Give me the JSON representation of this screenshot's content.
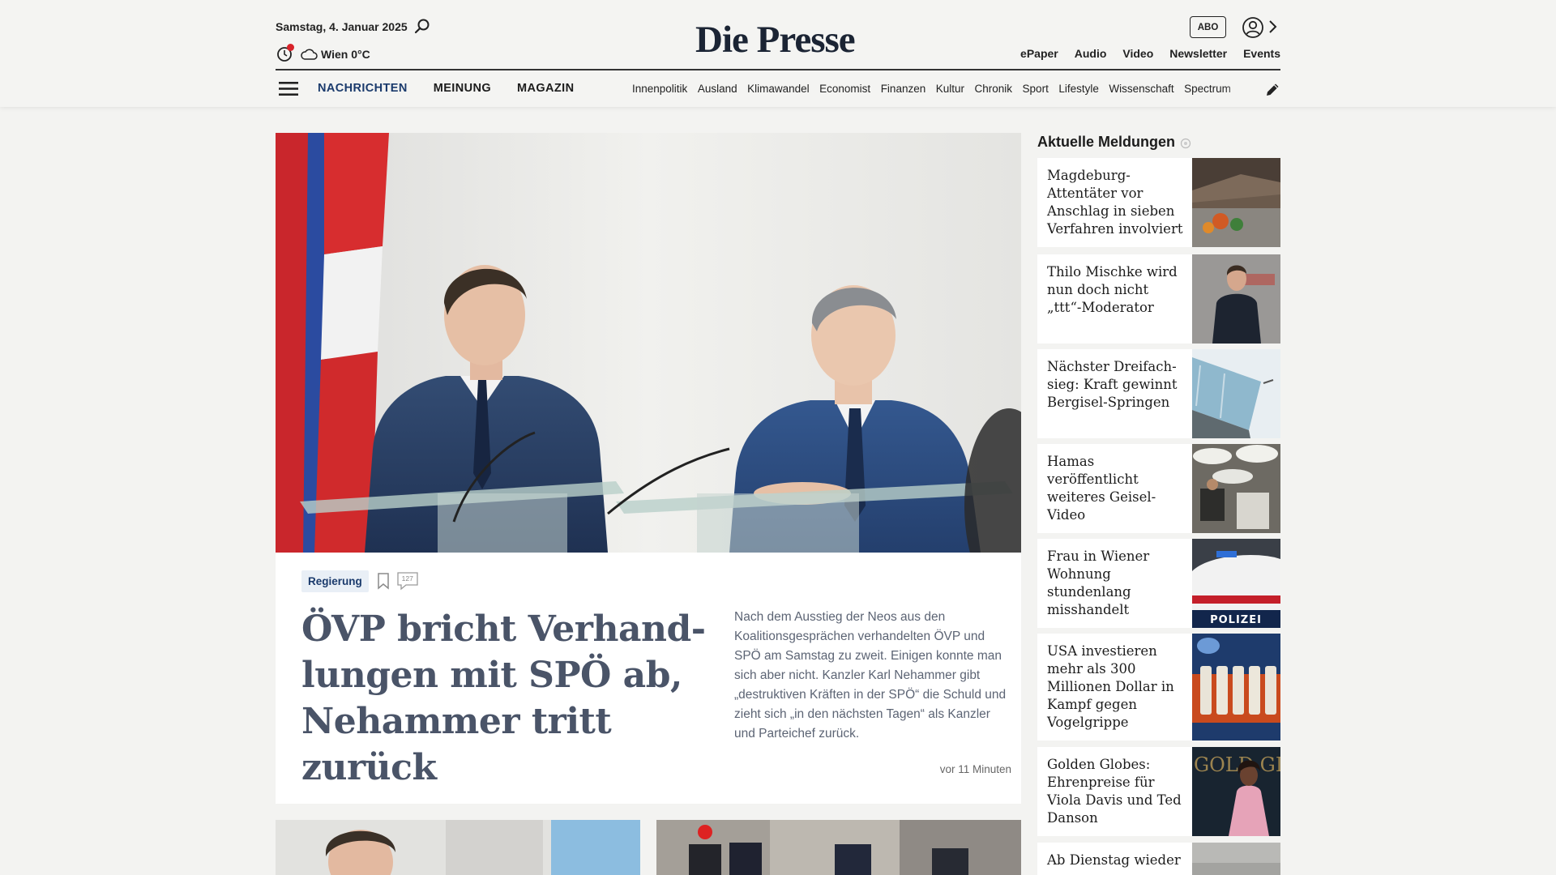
{
  "header": {
    "date": "Samstag, 4. Januar 2025",
    "weather": "Wien 0°C",
    "logo": "Die Presse",
    "abo_label": "ABO",
    "top_links": [
      "ePaper",
      "Audio",
      "Video",
      "Newsletter",
      "Events"
    ],
    "main_nav": [
      "NACHRICHTEN",
      "MEINUNG",
      "MAGAZIN"
    ],
    "sub_nav": [
      "Innenpolitik",
      "Ausland",
      "Klimawandel",
      "Economist",
      "Finanzen",
      "Kultur",
      "Chronik",
      "Sport",
      "Lifestyle",
      "Wissenschaft",
      "Spectrum"
    ]
  },
  "lead": {
    "category": "Regierung",
    "comment_count": "127",
    "headline": "ÖVP bricht Verhand­lungen mit SPÖ ab, Nehammer tritt zurück",
    "teaser": "Nach dem Ausstieg der Neos aus den Koalitionsgesprächen verhandelten ÖVP und SPÖ am Samstag zu zweit. Einigen konnte man sich aber nicht. Kanzler Karl Nehammer gibt „destruktiven Kräften in der SPÖ“ die Schuld und zieht sich „in den nächsten Tagen“ als Kanzler und Parteichef zurück.",
    "time": "vor 11 Minuten"
  },
  "aside": {
    "title": "Aktuelle Meldungen",
    "items": [
      {
        "title": "Magdeburg-Attentäter vor Anschlag in sieben Verfahren involviert"
      },
      {
        "title": "Thilo Mischke wird nun doch nicht „ttt“-Moderator"
      },
      {
        "title": "Nächster Dreifach-sieg: Kraft gewinnt Bergisel-Springen"
      },
      {
        "title": "Hamas veröffentlicht weiteres Geisel-Video"
      },
      {
        "title": "Frau in Wiener Wohnung stundenlang misshandelt"
      },
      {
        "title": "USA investieren mehr als 300 Millionen Dollar in Kampf gegen Vogelgrippe"
      },
      {
        "title": "Golden Globes: Ehrenpreise für Viola Davis und Ted Danson"
      },
      {
        "title": "Ab Dienstag wieder"
      }
    ],
    "thumb_texts": {
      "police": "POLIZEI",
      "globes": "GOLD GLO"
    }
  },
  "colors": {
    "accent": "#1a3a6c",
    "background": "#f3f3f1",
    "tag_bg": "#e9eff6",
    "notification": "#d8232a"
  },
  "icons": [
    "search-icon",
    "clock-icon",
    "cloud-icon",
    "user-icon",
    "chevron-right-icon",
    "menu-icon",
    "pencil-icon",
    "bookmark-icon",
    "comment-icon",
    "pulse-icon"
  ]
}
